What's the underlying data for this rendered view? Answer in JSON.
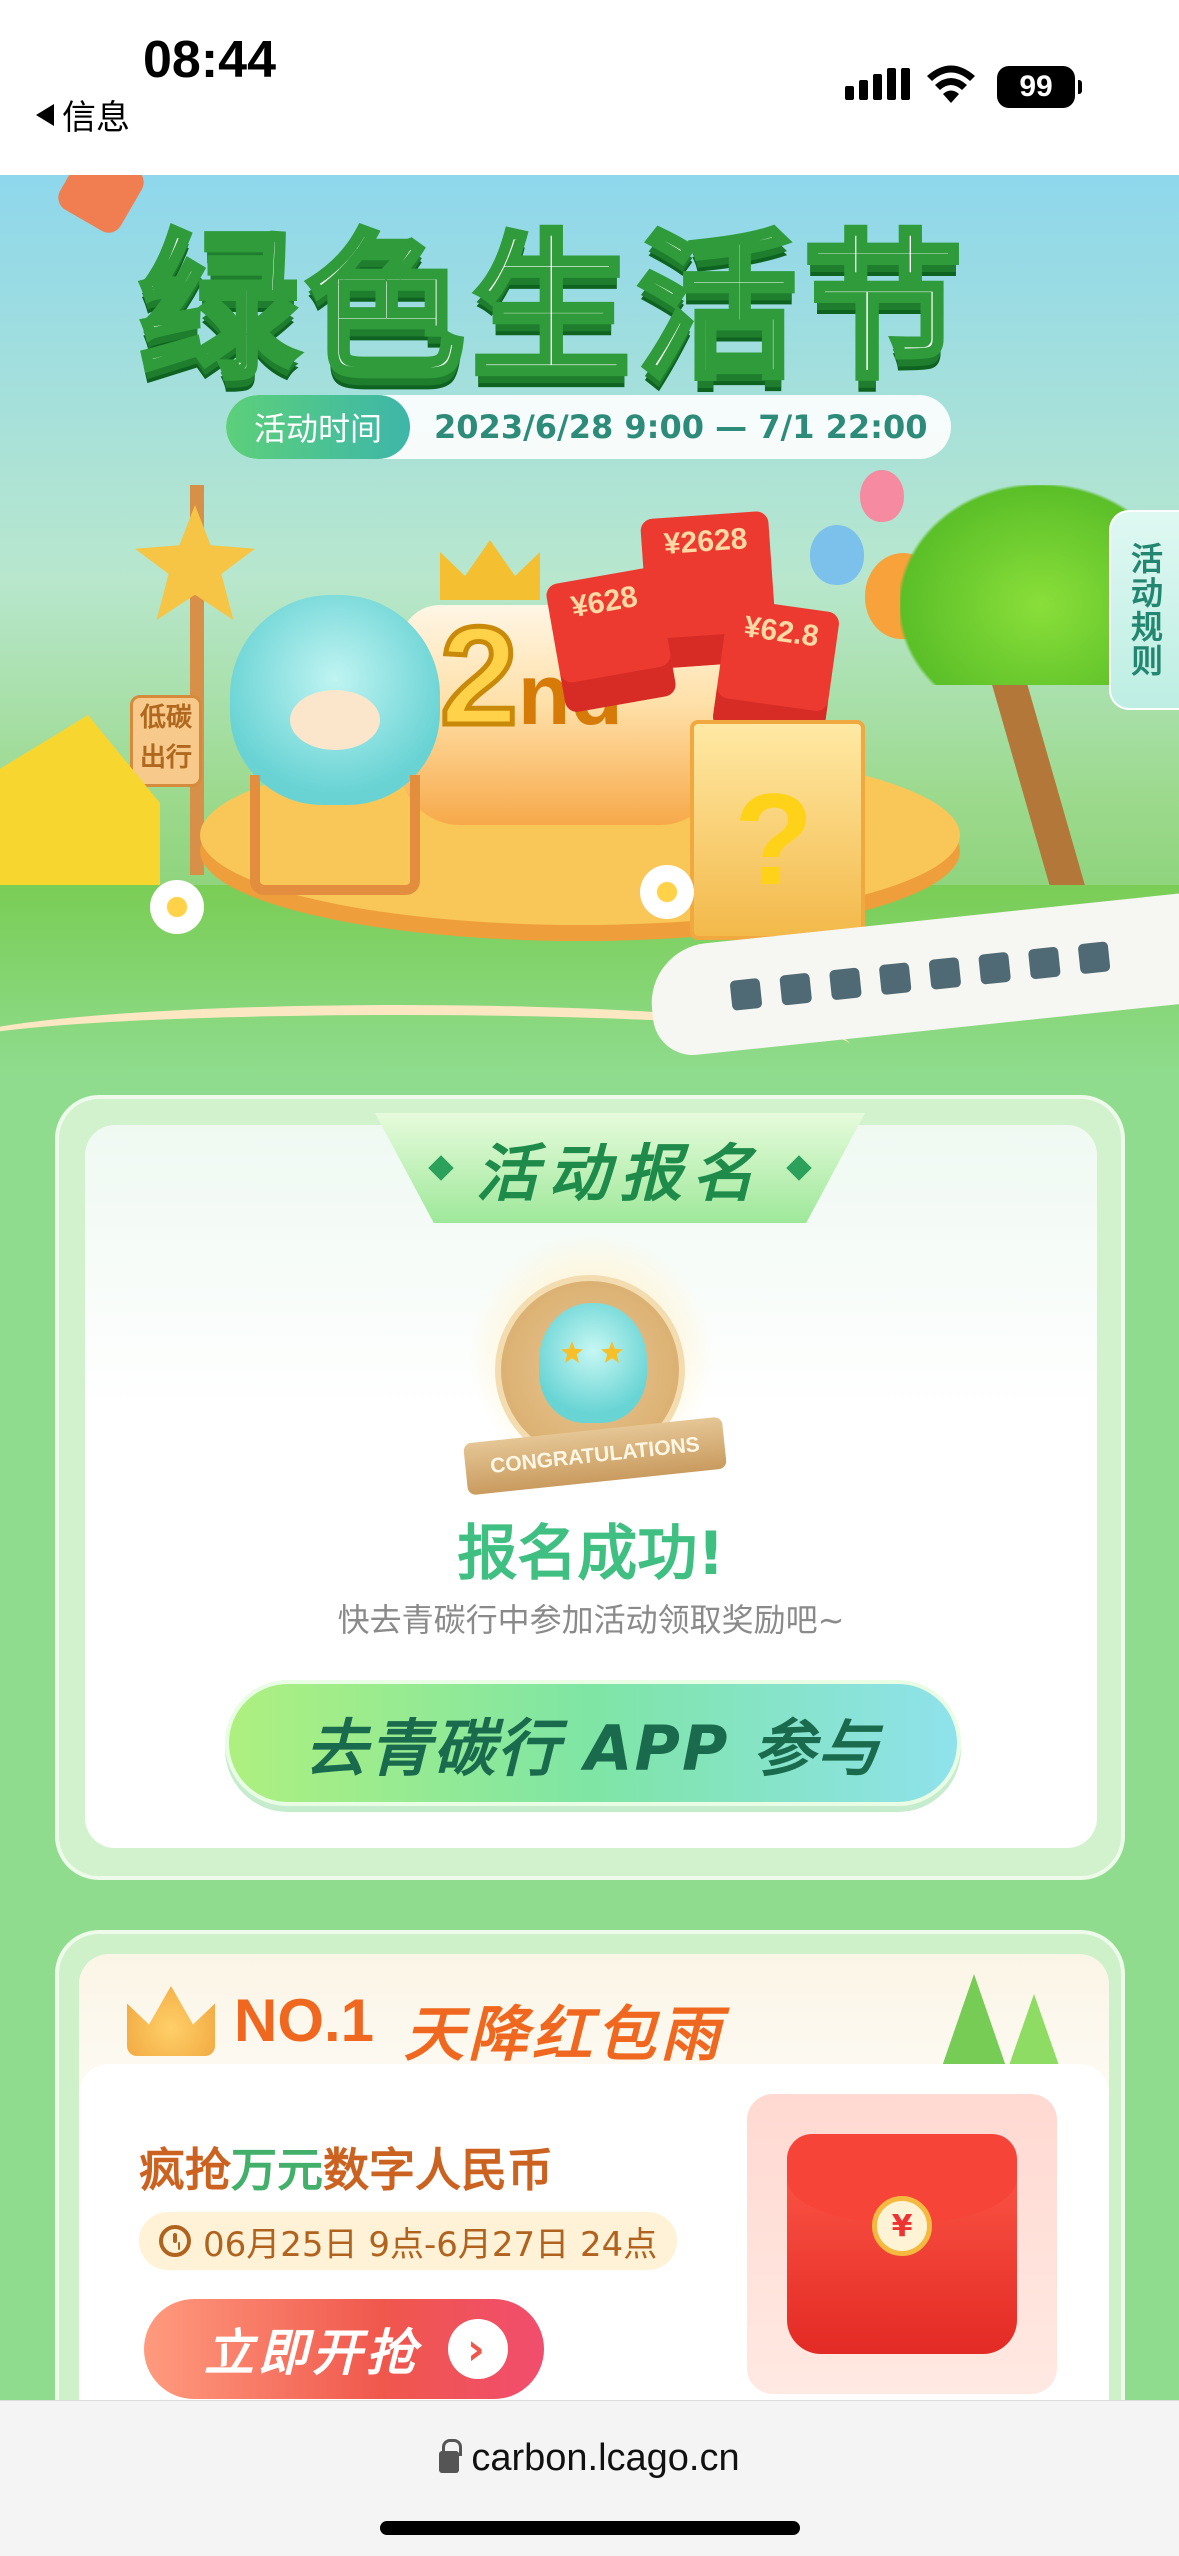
{
  "status_bar": {
    "time": "08:44",
    "back_label": "信息",
    "battery": "99"
  },
  "hero": {
    "title": "绿色生活节",
    "time_label": "活动时间",
    "time_value": "2023/6/28  9:00 — 7/1  22:00",
    "rules_label": "活动规则",
    "cake_text": "2",
    "cake_suffix": "nd",
    "envelopes": [
      "¥2628",
      "¥628",
      "¥62.8"
    ],
    "sign_text": "低碳出行",
    "box_text": "?"
  },
  "signup": {
    "ribbon": "活动报名",
    "medal_text": "CONGRATULATIONS",
    "success_title": "报名成功!",
    "success_sub": "快去青碳行中参加活动领取奖励吧~",
    "cta_label": "去青碳行 APP 参与"
  },
  "redpacket": {
    "rank": "NO.1",
    "title": "天降红包雨",
    "headline_a": "疯抢",
    "headline_b": "万元",
    "headline_c": "数字人民币",
    "date_range": "06月25日 9点-6月27日 24点",
    "grab_label": "立即开抢",
    "grab_arrow": "›",
    "coin_symbol": "¥"
  },
  "browser": {
    "url": "carbon.lcago.cn"
  },
  "colors": {
    "brand_green": "#3fbf81",
    "accent_orange": "#f0681f",
    "cta_red": "#f0574c"
  }
}
